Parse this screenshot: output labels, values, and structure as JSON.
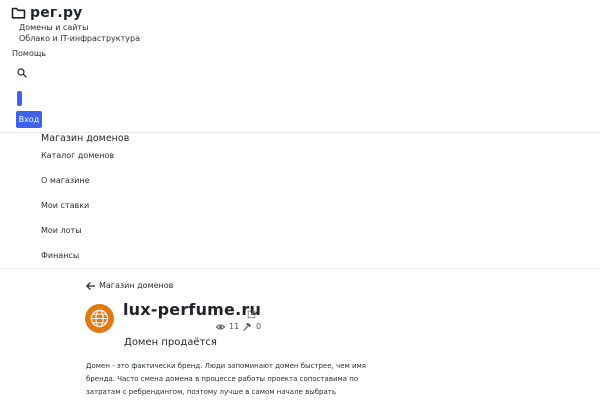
{
  "header": {
    "logo_text": "рег.ру",
    "nav": [
      "Домены и сайты",
      "Облако и IT-инфраструктура"
    ],
    "help_label": "Помощь",
    "login_label": "Вход",
    "accent_color": "#3e62ec"
  },
  "subnav": {
    "title": "Магазин доменов",
    "items": [
      "Каталог доменов",
      "О магазине",
      "Мои ставки",
      "Мои лоты",
      "Финансы"
    ]
  },
  "listing": {
    "back_label": "Магазин доменов",
    "domain": "lux-perfume.ru",
    "views": "11",
    "bids": "0",
    "status": "Домен продаётся",
    "description": "Домен - это фактически бренд. Люди запоминают домен быстрее, чем имя бренда. Часто смена домена в процессе работы проекта сопоставима по затратам с ребрендингом, поэтому лучше в самом начале выбрать правильный домен и сразу четко спозиционировать свой тов",
    "icon_color": "#e27a13"
  },
  "icons": [
    "folder-icon",
    "search-icon",
    "arrow-left-icon",
    "globe-icon",
    "external-link-icon",
    "eye-icon",
    "gavel-icon"
  ]
}
